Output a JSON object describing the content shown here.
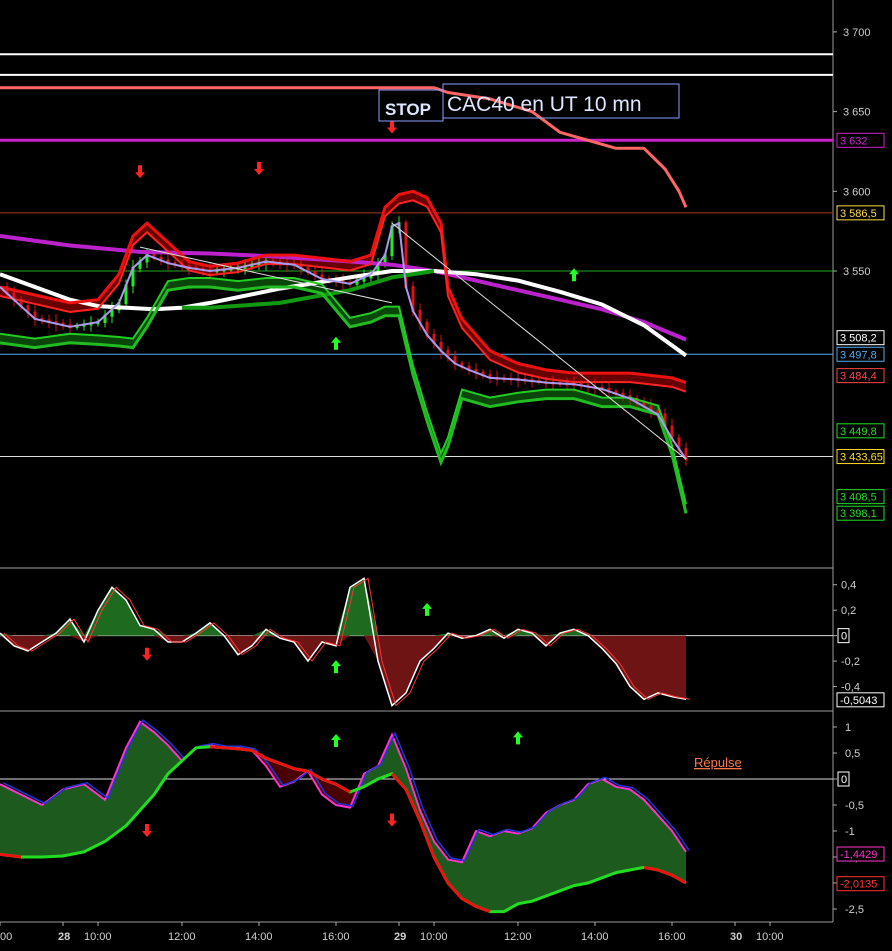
{
  "chart_data": [
    {
      "type": "line",
      "title": "CAC40 en UT 10 mn",
      "stop_label": "STOP",
      "y_ticks": [
        3550,
        3600,
        3650,
        3700
      ],
      "y_tick_labels": [
        "3 550",
        "3 600",
        "3 650",
        "3 700"
      ],
      "ylim": [
        3365,
        3720
      ],
      "n": 100,
      "x_tick_labels": [
        {
          "i": 0,
          "label": "00"
        },
        {
          "i": 9,
          "label": "28"
        },
        {
          "i": 14,
          "label": "10:00"
        },
        {
          "i": 26,
          "label": "12:00"
        },
        {
          "i": 37,
          "label": "14:00"
        },
        {
          "i": 48,
          "label": "16:00"
        },
        {
          "i": 57,
          "label": "29"
        },
        {
          "i": 62,
          "label": "10:00"
        },
        {
          "i": 74,
          "label": "12:00"
        },
        {
          "i": 85,
          "label": "14:00"
        },
        {
          "i": 96,
          "label": "16:00"
        },
        {
          "i": 105,
          "label": "30"
        },
        {
          "i": 110,
          "label": "10:00"
        }
      ],
      "hlines": [
        {
          "value": 3686,
          "color": "#ffffff"
        },
        {
          "value": 3673,
          "color": "#ffffff"
        },
        {
          "value": 3632,
          "color": "#cc22cc",
          "label": "3 632"
        },
        {
          "value": 3586.5,
          "color": "#aa3322",
          "label": "3 586,5"
        },
        {
          "value": 3550,
          "color": "#22aa22"
        },
        {
          "value": 3497.8,
          "color": "#55aaee",
          "label": "3 497,8"
        },
        {
          "value": 3433.65,
          "color": "#dddddd",
          "label": "3 433,65"
        }
      ],
      "price_labels": [
        {
          "value": 3508.2,
          "label": "3 508,2",
          "color": "#ffffff"
        },
        {
          "value": 3484.4,
          "label": "3 484,4",
          "color": "#ff4444"
        },
        {
          "value": 3449.8,
          "label": "3 449,8",
          "color": "#22dd22"
        },
        {
          "value": 3408.5,
          "label": "3 408,5",
          "color": "#22dd22"
        },
        {
          "value": 3398.1,
          "label": "3 398,1",
          "color": "#22dd22"
        }
      ],
      "series": [
        {
          "key": "stop",
          "color": "#ff6666",
          "width": 3,
          "x": [
            0,
            62,
            64,
            70,
            76,
            80,
            84,
            88,
            92,
            95,
            97,
            98
          ],
          "values": [
            3665,
            3665,
            3662,
            3658,
            3650,
            3637,
            3632,
            3627,
            3627,
            3614,
            3600,
            3590
          ]
        },
        {
          "key": "ma_magenta",
          "color": "#bb22cc",
          "width": 4,
          "x": [
            0,
            10,
            20,
            30,
            40,
            50,
            56,
            62,
            68,
            74,
            80,
            86,
            92,
            98
          ],
          "values": [
            3572,
            3566,
            3562,
            3561,
            3559,
            3556,
            3554,
            3550,
            3544,
            3538,
            3532,
            3526,
            3518,
            3507
          ]
        },
        {
          "key": "ma_white",
          "color": "#ffffff",
          "width": 4,
          "x": [
            0,
            5,
            10,
            14,
            18,
            22,
            26,
            30,
            40,
            50,
            56,
            62,
            68,
            74,
            80,
            86,
            92,
            98
          ],
          "values": [
            3548,
            3540,
            3532,
            3528,
            3527,
            3526,
            3527,
            3530,
            3539,
            3546,
            3550,
            3550,
            3548,
            3544,
            3537,
            3529,
            3516,
            3497
          ]
        },
        {
          "key": "ma_green",
          "color": "#119911",
          "width": 4,
          "x": [
            26,
            30,
            40,
            50,
            56,
            62
          ],
          "values": [
            3527,
            3527,
            3530,
            3538,
            3546,
            3550
          ]
        },
        {
          "key": "env_red",
          "color": "#ee1111",
          "width": 3,
          "x": [
            0,
            5,
            10,
            14,
            17,
            19,
            21,
            24,
            27,
            30,
            34,
            38,
            42,
            46,
            50,
            53,
            55,
            57,
            59,
            61,
            63,
            64,
            66,
            70,
            74,
            78,
            82,
            86,
            90,
            94,
            96,
            98
          ],
          "values": [
            3540,
            3535,
            3530,
            3532,
            3548,
            3572,
            3580,
            3568,
            3556,
            3553,
            3555,
            3560,
            3560,
            3558,
            3556,
            3560,
            3590,
            3598,
            3600,
            3596,
            3580,
            3540,
            3520,
            3500,
            3492,
            3488,
            3486,
            3486,
            3486,
            3484,
            3483,
            3480
          ]
        },
        {
          "key": "env_green",
          "color": "#22bb22",
          "width": 3,
          "x": [
            0,
            5,
            10,
            14,
            17,
            19,
            21,
            24,
            27,
            30,
            34,
            38,
            42,
            46,
            50,
            53,
            55,
            57,
            59,
            61,
            63,
            64,
            66,
            70,
            74,
            78,
            82,
            86,
            90,
            94,
            96,
            98
          ],
          "values": [
            3505,
            3502,
            3505,
            3504,
            3503,
            3502,
            3515,
            3538,
            3540,
            3540,
            3538,
            3540,
            3540,
            3536,
            3515,
            3518,
            3522,
            3522,
            3485,
            3456,
            3430,
            3440,
            3470,
            3465,
            3468,
            3470,
            3470,
            3465,
            3465,
            3460,
            3435,
            3398
          ]
        },
        {
          "key": "price",
          "color": "#aa99ee",
          "width": 2,
          "x": [
            0,
            5,
            10,
            14,
            17,
            19,
            21,
            24,
            27,
            30,
            34,
            38,
            42,
            46,
            50,
            53,
            55,
            56,
            57,
            58,
            59,
            61,
            63,
            65,
            67,
            70,
            74,
            78,
            82,
            86,
            90,
            94,
            96,
            98
          ],
          "values": [
            3540,
            3520,
            3515,
            3518,
            3530,
            3552,
            3560,
            3555,
            3552,
            3550,
            3552,
            3556,
            3554,
            3545,
            3542,
            3548,
            3560,
            3578,
            3580,
            3540,
            3525,
            3510,
            3500,
            3492,
            3488,
            3483,
            3482,
            3480,
            3479,
            3476,
            3470,
            3460,
            3445,
            3432
          ]
        },
        {
          "key": "trend",
          "color": "#dddddd",
          "width": 1,
          "x": [
            56,
            98
          ],
          "values": [
            3580,
            3432
          ]
        },
        {
          "key": "trend2",
          "color": "#dddddd",
          "width": 1,
          "x": [
            20,
            56
          ],
          "values": [
            3565,
            3530
          ]
        }
      ],
      "arrows": [
        {
          "i": 20,
          "value": 3612,
          "dir": "down"
        },
        {
          "i": 37,
          "value": 3614,
          "dir": "down"
        },
        {
          "i": 56,
          "value": 3640,
          "dir": "down"
        },
        {
          "i": 48,
          "value": 3505,
          "dir": "up"
        },
        {
          "i": 82,
          "value": 3548,
          "dir": "up"
        }
      ]
    },
    {
      "type": "area",
      "ylim": [
        -0.6,
        0.5
      ],
      "y_ticks": [
        0.4,
        0.2,
        0,
        -0.2,
        -0.4
      ],
      "y_tick_labels": [
        "0,4",
        "0,2",
        "0",
        "-0,2",
        "-0,4"
      ],
      "zero_label": "0",
      "last_value": -0.5043,
      "last_label": "-0,5043",
      "series": [
        {
          "key": "osc",
          "x": [
            0,
            2,
            4,
            6,
            8,
            10,
            12,
            14,
            16,
            18,
            20,
            22,
            24,
            26,
            28,
            30,
            32,
            34,
            36,
            38,
            40,
            42,
            44,
            46,
            48,
            50,
            52,
            54,
            56,
            58,
            60,
            62,
            64,
            66,
            68,
            70,
            72,
            74,
            76,
            78,
            80,
            82,
            84,
            86,
            88,
            90,
            92,
            94,
            96,
            98
          ],
          "values": [
            0.02,
            -0.08,
            -0.12,
            -0.05,
            0.02,
            0.13,
            -0.05,
            0.2,
            0.38,
            0.28,
            0.08,
            0.05,
            -0.05,
            -0.05,
            0.02,
            0.1,
            0.0,
            -0.15,
            -0.08,
            0.05,
            -0.02,
            -0.05,
            -0.2,
            -0.05,
            -0.08,
            0.38,
            0.45,
            -0.2,
            -0.55,
            -0.45,
            -0.2,
            -0.1,
            0.02,
            -0.02,
            0.0,
            0.05,
            -0.02,
            0.05,
            0.02,
            -0.08,
            0.02,
            0.05,
            0.0,
            -0.1,
            -0.22,
            -0.4,
            -0.5,
            -0.45,
            -0.48,
            -0.5
          ]
        }
      ],
      "arrows": [
        {
          "i": 21,
          "value": -0.15,
          "dir": "down"
        },
        {
          "i": 48,
          "value": -0.24,
          "dir": "up"
        },
        {
          "i": 61,
          "value": 0.21,
          "dir": "up"
        }
      ]
    },
    {
      "type": "area",
      "ylim": [
        -2.75,
        1.25
      ],
      "y_ticks": [
        1,
        0.5,
        0,
        -0.5,
        -1,
        -1.5,
        -2,
        -2.5
      ],
      "y_tick_labels": [
        "1",
        "0,5",
        "0",
        "-0,5",
        "-1",
        "-1,5",
        "-2",
        "-2,5"
      ],
      "zero_label": "0",
      "annotation": "Répulse",
      "series": [
        {
          "key": "rep_fast",
          "x": [
            0,
            3,
            6,
            9,
            12,
            15,
            18,
            20,
            22,
            24,
            26,
            28,
            30,
            32,
            34,
            36,
            38,
            40,
            42,
            44,
            46,
            48,
            50,
            52,
            54,
            56,
            58,
            60,
            62,
            64,
            66,
            68,
            70,
            72,
            74,
            76,
            78,
            80,
            82,
            84,
            86,
            88,
            90,
            92,
            94,
            96,
            98
          ],
          "values": [
            -0.1,
            -0.3,
            -0.5,
            -0.2,
            -0.1,
            -0.4,
            0.6,
            1.1,
            0.9,
            0.65,
            0.35,
            0.6,
            0.65,
            0.6,
            0.6,
            0.55,
            0.25,
            -0.15,
            -0.05,
            0.15,
            -0.3,
            -0.5,
            -0.55,
            0.1,
            0.25,
            0.85,
            0.2,
            -0.6,
            -1.2,
            -1.55,
            -1.6,
            -1.0,
            -1.1,
            -1.0,
            -1.05,
            -0.95,
            -0.65,
            -0.5,
            -0.4,
            -0.1,
            0.0,
            -0.15,
            -0.2,
            -0.4,
            -0.7,
            -1.0,
            -1.4
          ]
        },
        {
          "key": "rep_slow",
          "x": [
            0,
            3,
            6,
            9,
            12,
            15,
            18,
            20,
            22,
            24,
            26,
            28,
            30,
            32,
            34,
            36,
            38,
            40,
            42,
            44,
            46,
            48,
            50,
            52,
            54,
            56,
            58,
            60,
            62,
            64,
            66,
            68,
            70,
            72,
            74,
            76,
            78,
            80,
            82,
            84,
            86,
            88,
            90,
            92,
            94,
            96,
            98
          ],
          "values": [
            -1.45,
            -1.5,
            -1.5,
            -1.48,
            -1.4,
            -1.2,
            -0.9,
            -0.6,
            -0.3,
            0.1,
            0.35,
            0.6,
            0.62,
            0.6,
            0.58,
            0.55,
            0.4,
            0.3,
            0.2,
            0.15,
            0.0,
            -0.1,
            -0.25,
            -0.15,
            0.0,
            0.1,
            -0.2,
            -0.8,
            -1.5,
            -2.0,
            -2.3,
            -2.45,
            -2.55,
            -2.55,
            -2.4,
            -2.35,
            -2.25,
            -2.15,
            -2.05,
            -2.0,
            -1.9,
            -1.8,
            -1.75,
            -1.7,
            -1.75,
            -1.85,
            -2.0
          ]
        }
      ],
      "last_labels": [
        {
          "value": -1.4429,
          "label": "-1,4429",
          "color": "#ff33cc"
        },
        {
          "value": -2.0135,
          "label": "-2,0135",
          "color": "#ff3333"
        }
      ],
      "arrows": [
        {
          "i": 21,
          "value": -1.0,
          "dir": "down"
        },
        {
          "i": 48,
          "value": 0.75,
          "dir": "up"
        },
        {
          "i": 56,
          "value": -0.8,
          "dir": "down"
        },
        {
          "i": 74,
          "value": 0.8,
          "dir": "up"
        }
      ]
    }
  ]
}
